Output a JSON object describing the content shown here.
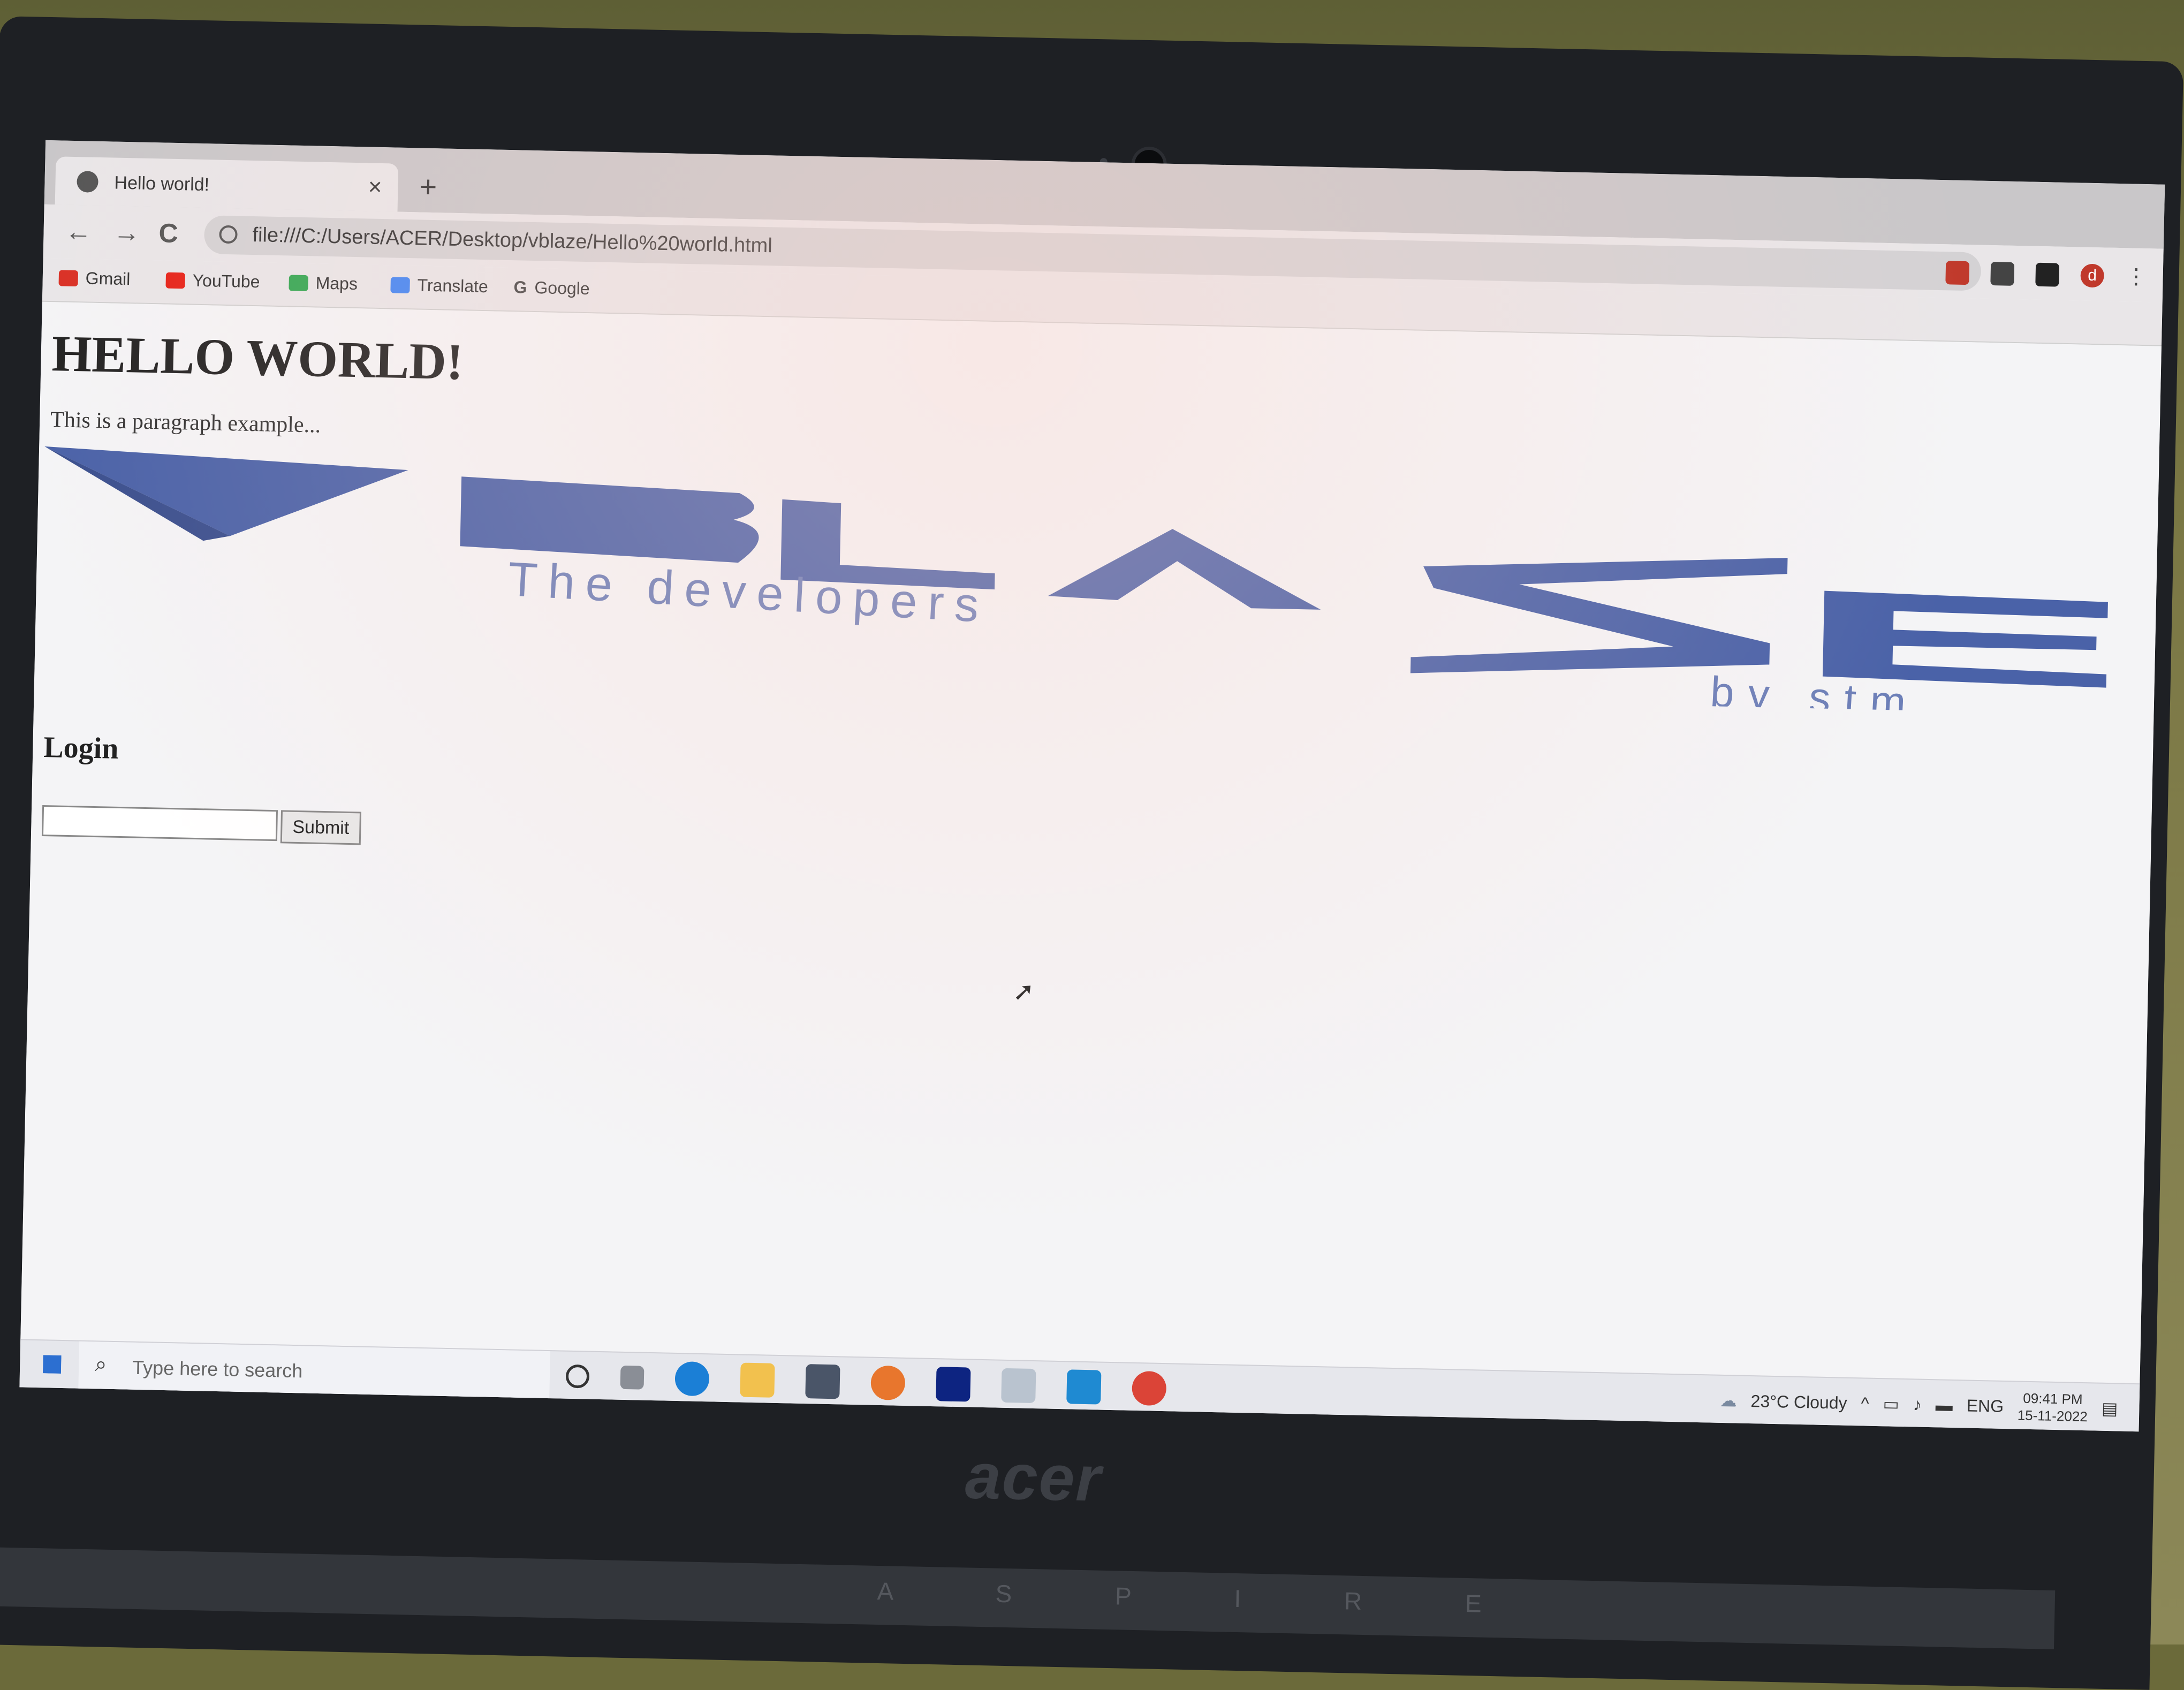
{
  "browser": {
    "tab_title": "Hello world!",
    "tab_close": "×",
    "new_tab": "+",
    "url": "file:///C:/Users/ACER/Desktop/vblaze/Hello%20world.html",
    "nav": {
      "back": "←",
      "forward": "→",
      "reload": "C"
    },
    "bookmarks": [
      {
        "label": "Gmail",
        "icon": "gmail-icon",
        "color": "#d93025"
      },
      {
        "label": "YouTube",
        "icon": "youtube-icon",
        "color": "#e62117"
      },
      {
        "label": "Maps",
        "icon": "maps-icon",
        "color": "#34a853"
      },
      {
        "label": "Translate",
        "icon": "translate-icon",
        "color": "#4285f4"
      },
      {
        "label": "Google",
        "icon": "google-icon",
        "color": "#4285f4"
      }
    ],
    "profile_initial": "d"
  },
  "page": {
    "heading": "HELLO WORLD!",
    "paragraph": "This is a paragraph example...",
    "logo_text": "VBLASE",
    "logo_tagline": "The developers",
    "logo_byline": "by stm",
    "login_heading": "Login",
    "submit_label": "Submit"
  },
  "taskbar": {
    "search_placeholder": "Type here to search",
    "weather": "23°C  Cloudy",
    "lang": "ENG",
    "time": "09:41 PM",
    "date": "15-11-2022"
  },
  "bezel": {
    "brand": "acer",
    "model": "A S P I R E"
  },
  "colors": {
    "logo_blue": "#4a62a8",
    "taskbar_bg": "#e6e7ec"
  }
}
